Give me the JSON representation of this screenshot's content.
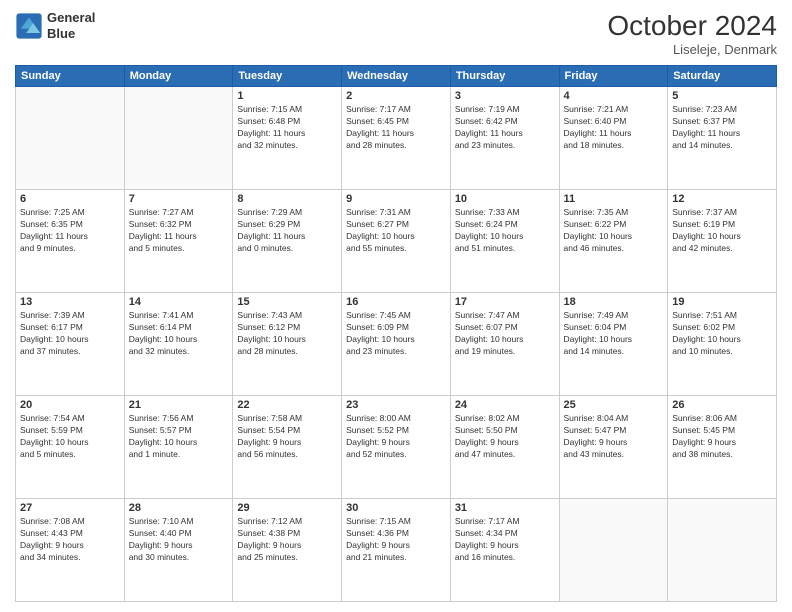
{
  "header": {
    "logo_line1": "General",
    "logo_line2": "Blue",
    "month": "October 2024",
    "location": "Liseleje, Denmark"
  },
  "days_of_week": [
    "Sunday",
    "Monday",
    "Tuesday",
    "Wednesday",
    "Thursday",
    "Friday",
    "Saturday"
  ],
  "weeks": [
    [
      {
        "day": "",
        "content": ""
      },
      {
        "day": "",
        "content": ""
      },
      {
        "day": "1",
        "content": "Sunrise: 7:15 AM\nSunset: 6:48 PM\nDaylight: 11 hours\nand 32 minutes."
      },
      {
        "day": "2",
        "content": "Sunrise: 7:17 AM\nSunset: 6:45 PM\nDaylight: 11 hours\nand 28 minutes."
      },
      {
        "day": "3",
        "content": "Sunrise: 7:19 AM\nSunset: 6:42 PM\nDaylight: 11 hours\nand 23 minutes."
      },
      {
        "day": "4",
        "content": "Sunrise: 7:21 AM\nSunset: 6:40 PM\nDaylight: 11 hours\nand 18 minutes."
      },
      {
        "day": "5",
        "content": "Sunrise: 7:23 AM\nSunset: 6:37 PM\nDaylight: 11 hours\nand 14 minutes."
      }
    ],
    [
      {
        "day": "6",
        "content": "Sunrise: 7:25 AM\nSunset: 6:35 PM\nDaylight: 11 hours\nand 9 minutes."
      },
      {
        "day": "7",
        "content": "Sunrise: 7:27 AM\nSunset: 6:32 PM\nDaylight: 11 hours\nand 5 minutes."
      },
      {
        "day": "8",
        "content": "Sunrise: 7:29 AM\nSunset: 6:29 PM\nDaylight: 11 hours\nand 0 minutes."
      },
      {
        "day": "9",
        "content": "Sunrise: 7:31 AM\nSunset: 6:27 PM\nDaylight: 10 hours\nand 55 minutes."
      },
      {
        "day": "10",
        "content": "Sunrise: 7:33 AM\nSunset: 6:24 PM\nDaylight: 10 hours\nand 51 minutes."
      },
      {
        "day": "11",
        "content": "Sunrise: 7:35 AM\nSunset: 6:22 PM\nDaylight: 10 hours\nand 46 minutes."
      },
      {
        "day": "12",
        "content": "Sunrise: 7:37 AM\nSunset: 6:19 PM\nDaylight: 10 hours\nand 42 minutes."
      }
    ],
    [
      {
        "day": "13",
        "content": "Sunrise: 7:39 AM\nSunset: 6:17 PM\nDaylight: 10 hours\nand 37 minutes."
      },
      {
        "day": "14",
        "content": "Sunrise: 7:41 AM\nSunset: 6:14 PM\nDaylight: 10 hours\nand 32 minutes."
      },
      {
        "day": "15",
        "content": "Sunrise: 7:43 AM\nSunset: 6:12 PM\nDaylight: 10 hours\nand 28 minutes."
      },
      {
        "day": "16",
        "content": "Sunrise: 7:45 AM\nSunset: 6:09 PM\nDaylight: 10 hours\nand 23 minutes."
      },
      {
        "day": "17",
        "content": "Sunrise: 7:47 AM\nSunset: 6:07 PM\nDaylight: 10 hours\nand 19 minutes."
      },
      {
        "day": "18",
        "content": "Sunrise: 7:49 AM\nSunset: 6:04 PM\nDaylight: 10 hours\nand 14 minutes."
      },
      {
        "day": "19",
        "content": "Sunrise: 7:51 AM\nSunset: 6:02 PM\nDaylight: 10 hours\nand 10 minutes."
      }
    ],
    [
      {
        "day": "20",
        "content": "Sunrise: 7:54 AM\nSunset: 5:59 PM\nDaylight: 10 hours\nand 5 minutes."
      },
      {
        "day": "21",
        "content": "Sunrise: 7:56 AM\nSunset: 5:57 PM\nDaylight: 10 hours\nand 1 minute."
      },
      {
        "day": "22",
        "content": "Sunrise: 7:58 AM\nSunset: 5:54 PM\nDaylight: 9 hours\nand 56 minutes."
      },
      {
        "day": "23",
        "content": "Sunrise: 8:00 AM\nSunset: 5:52 PM\nDaylight: 9 hours\nand 52 minutes."
      },
      {
        "day": "24",
        "content": "Sunrise: 8:02 AM\nSunset: 5:50 PM\nDaylight: 9 hours\nand 47 minutes."
      },
      {
        "day": "25",
        "content": "Sunrise: 8:04 AM\nSunset: 5:47 PM\nDaylight: 9 hours\nand 43 minutes."
      },
      {
        "day": "26",
        "content": "Sunrise: 8:06 AM\nSunset: 5:45 PM\nDaylight: 9 hours\nand 38 minutes."
      }
    ],
    [
      {
        "day": "27",
        "content": "Sunrise: 7:08 AM\nSunset: 4:43 PM\nDaylight: 9 hours\nand 34 minutes."
      },
      {
        "day": "28",
        "content": "Sunrise: 7:10 AM\nSunset: 4:40 PM\nDaylight: 9 hours\nand 30 minutes."
      },
      {
        "day": "29",
        "content": "Sunrise: 7:12 AM\nSunset: 4:38 PM\nDaylight: 9 hours\nand 25 minutes."
      },
      {
        "day": "30",
        "content": "Sunrise: 7:15 AM\nSunset: 4:36 PM\nDaylight: 9 hours\nand 21 minutes."
      },
      {
        "day": "31",
        "content": "Sunrise: 7:17 AM\nSunset: 4:34 PM\nDaylight: 9 hours\nand 16 minutes."
      },
      {
        "day": "",
        "content": ""
      },
      {
        "day": "",
        "content": ""
      }
    ]
  ]
}
